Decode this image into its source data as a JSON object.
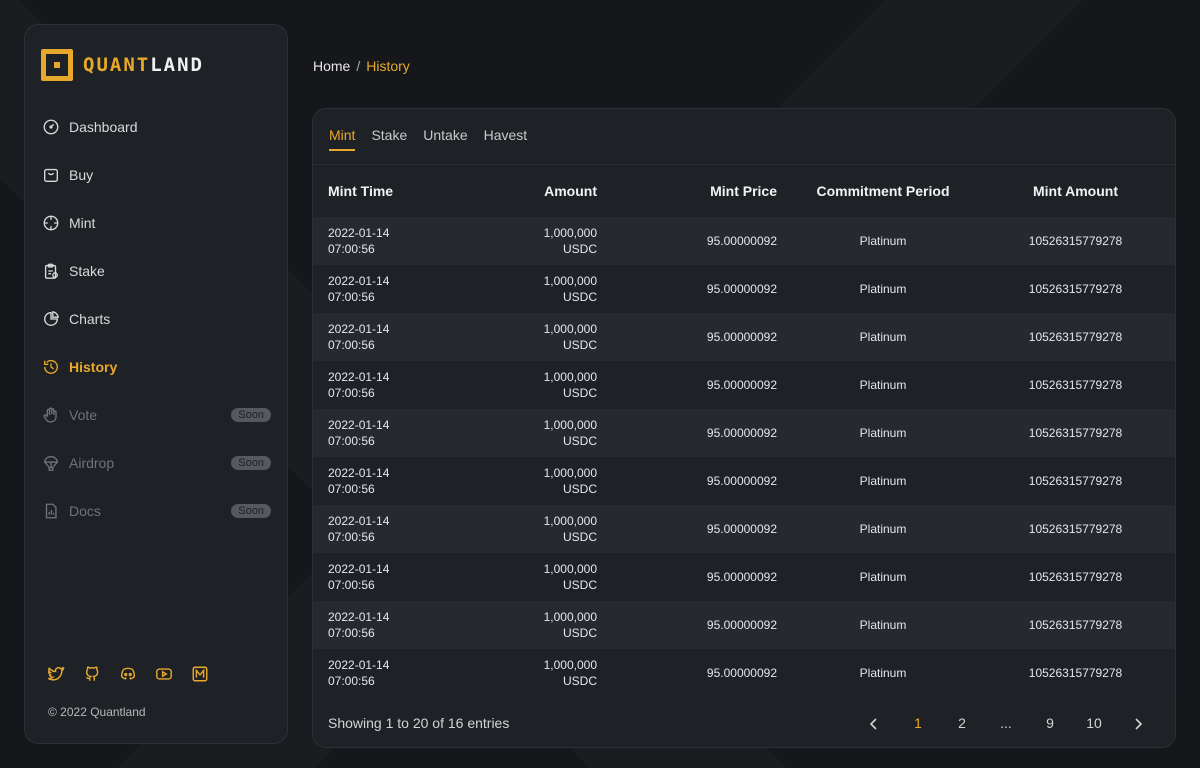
{
  "brand": {
    "name_part1": "QUANT",
    "name_part2": "LAND"
  },
  "sidebar": {
    "items": [
      {
        "label": "Dashboard",
        "icon": "dashboard-icon",
        "state": "normal"
      },
      {
        "label": "Buy",
        "icon": "shopping-bag-icon",
        "state": "normal"
      },
      {
        "label": "Mint",
        "icon": "crosshair-icon",
        "state": "normal"
      },
      {
        "label": "Stake",
        "icon": "clipboard-icon",
        "state": "normal"
      },
      {
        "label": "Charts",
        "icon": "pie-chart-icon",
        "state": "normal"
      },
      {
        "label": "History",
        "icon": "history-icon",
        "state": "active"
      },
      {
        "label": "Vote",
        "icon": "hand-icon",
        "state": "disabled",
        "badge": "Soon"
      },
      {
        "label": "Airdrop",
        "icon": "parachute-icon",
        "state": "disabled",
        "badge": "Soon"
      },
      {
        "label": "Docs",
        "icon": "document-icon",
        "state": "disabled",
        "badge": "Soon"
      }
    ],
    "social_icons": [
      "twitter-icon",
      "github-icon",
      "discord-icon",
      "youtube-icon",
      "medium-icon"
    ],
    "copyright": "© 2022 Quantland"
  },
  "breadcrumb": {
    "home": "Home",
    "separator": "/",
    "current": "History"
  },
  "tabs": [
    "Mint",
    "Stake",
    "Untake",
    "Havest"
  ],
  "active_tab": "Mint",
  "table": {
    "headers": [
      "Mint Time",
      "Amount",
      "Mint Price",
      "Commitment Period",
      "Mint Amount"
    ],
    "rows": [
      {
        "date": "2022-01-14",
        "time": "07:00:56",
        "amount": "1,000,000",
        "currency": "USDC",
        "price": "95.00000092",
        "period": "Platinum",
        "mint_amount": "10526315779278"
      },
      {
        "date": "2022-01-14",
        "time": "07:00:56",
        "amount": "1,000,000",
        "currency": "USDC",
        "price": "95.00000092",
        "period": "Platinum",
        "mint_amount": "10526315779278"
      },
      {
        "date": "2022-01-14",
        "time": "07:00:56",
        "amount": "1,000,000",
        "currency": "USDC",
        "price": "95.00000092",
        "period": "Platinum",
        "mint_amount": "10526315779278"
      },
      {
        "date": "2022-01-14",
        "time": "07:00:56",
        "amount": "1,000,000",
        "currency": "USDC",
        "price": "95.00000092",
        "period": "Platinum",
        "mint_amount": "10526315779278"
      },
      {
        "date": "2022-01-14",
        "time": "07:00:56",
        "amount": "1,000,000",
        "currency": "USDC",
        "price": "95.00000092",
        "period": "Platinum",
        "mint_amount": "10526315779278"
      },
      {
        "date": "2022-01-14",
        "time": "07:00:56",
        "amount": "1,000,000",
        "currency": "USDC",
        "price": "95.00000092",
        "period": "Platinum",
        "mint_amount": "10526315779278"
      },
      {
        "date": "2022-01-14",
        "time": "07:00:56",
        "amount": "1,000,000",
        "currency": "USDC",
        "price": "95.00000092",
        "period": "Platinum",
        "mint_amount": "10526315779278"
      },
      {
        "date": "2022-01-14",
        "time": "07:00:56",
        "amount": "1,000,000",
        "currency": "USDC",
        "price": "95.00000092",
        "period": "Platinum",
        "mint_amount": "10526315779278"
      },
      {
        "date": "2022-01-14",
        "time": "07:00:56",
        "amount": "1,000,000",
        "currency": "USDC",
        "price": "95.00000092",
        "period": "Platinum",
        "mint_amount": "10526315779278"
      },
      {
        "date": "2022-01-14",
        "time": "07:00:56",
        "amount": "1,000,000",
        "currency": "USDC",
        "price": "95.00000092",
        "period": "Platinum",
        "mint_amount": "10526315779278"
      }
    ]
  },
  "pagination": {
    "summary": "Showing 1 to 20 of 16 entries",
    "pages": [
      "1",
      "2",
      "...",
      "9",
      "10"
    ],
    "active_page": "1",
    "prev_icon": "chevron-left-icon",
    "next_icon": "chevron-right-icon"
  },
  "colors": {
    "accent": "#e7a92b",
    "background": "#15171b",
    "panel": "#1e2126"
  }
}
